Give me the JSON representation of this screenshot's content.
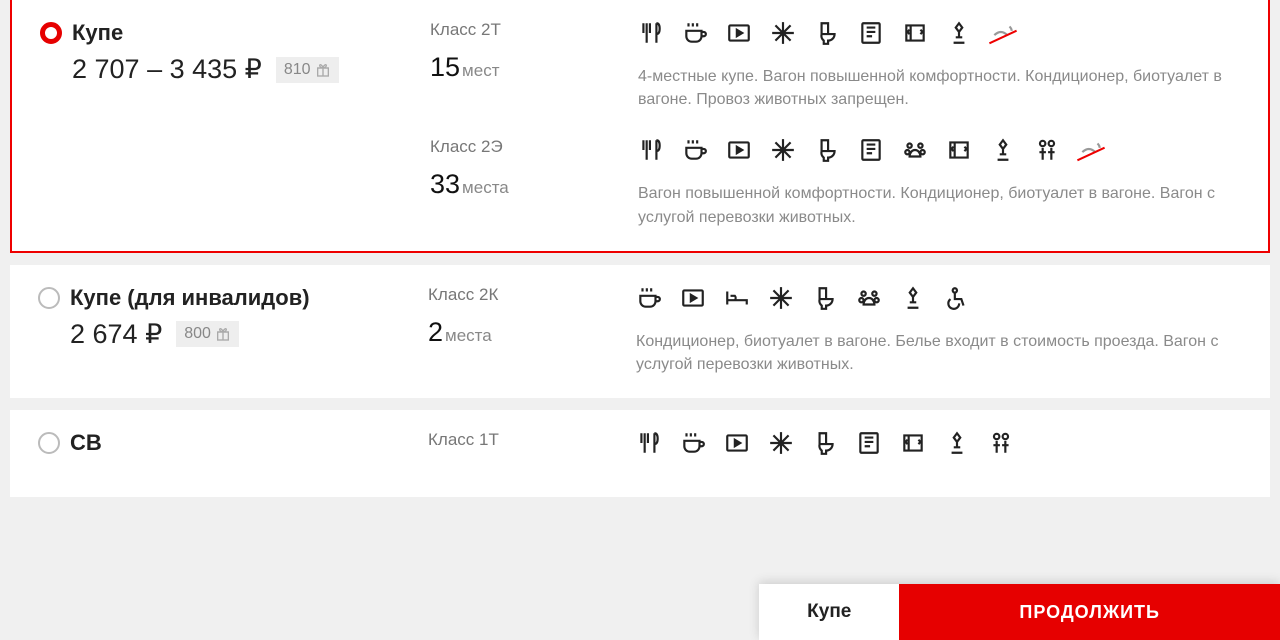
{
  "fares": [
    {
      "selected": true,
      "title": "Купе",
      "price": "2 707 – 3 435 ₽",
      "bonus": "810",
      "classes": [
        {
          "name": "Класс 2Т",
          "seats_num": "15",
          "seats_unit": "мест",
          "amenities": [
            "food",
            "cup",
            "tv",
            "ac",
            "toilet",
            "press",
            "ebook",
            "bed",
            "no-pets"
          ],
          "desc": "4-местные купе. Вагон повышенной комфортности. Кондиционер, биотуалет в вагоне. Провоз животных запрещен."
        },
        {
          "name": "Класс 2Э",
          "seats_num": "33",
          "seats_unit": "места",
          "amenities": [
            "food",
            "cup",
            "tv",
            "ac",
            "toilet",
            "press",
            "pets",
            "ebook",
            "bed",
            "people",
            "no-smoking"
          ],
          "desc": "Вагон повышенной комфортности. Кондиционер, биотуалет в вагоне. Вагон с услугой перевозки животных."
        }
      ]
    },
    {
      "selected": false,
      "title": "Купе (для инвалидов)",
      "price": "2 674 ₽",
      "bonus": "800",
      "classes": [
        {
          "name": "Класс 2К",
          "seats_num": "2",
          "seats_unit": "места",
          "amenities": [
            "cup",
            "tv",
            "sleep",
            "ac",
            "toilet",
            "pets",
            "bed",
            "wheelchair"
          ],
          "desc": "Кондиционер, биотуалет в вагоне. Белье входит в стоимость проезда. Вагон с услугой перевозки животных."
        }
      ]
    },
    {
      "selected": false,
      "title": "СВ",
      "price": "",
      "bonus": "",
      "classes": [
        {
          "name": "Класс 1Т",
          "seats_num": "",
          "seats_unit": "",
          "amenities": [
            "food",
            "cup",
            "tv",
            "ac",
            "toilet",
            "press",
            "ebook",
            "bed",
            "people"
          ],
          "desc": ""
        }
      ]
    }
  ],
  "footer": {
    "selected_label": "Купе",
    "continue": "ПРОДОЛЖИТЬ"
  }
}
